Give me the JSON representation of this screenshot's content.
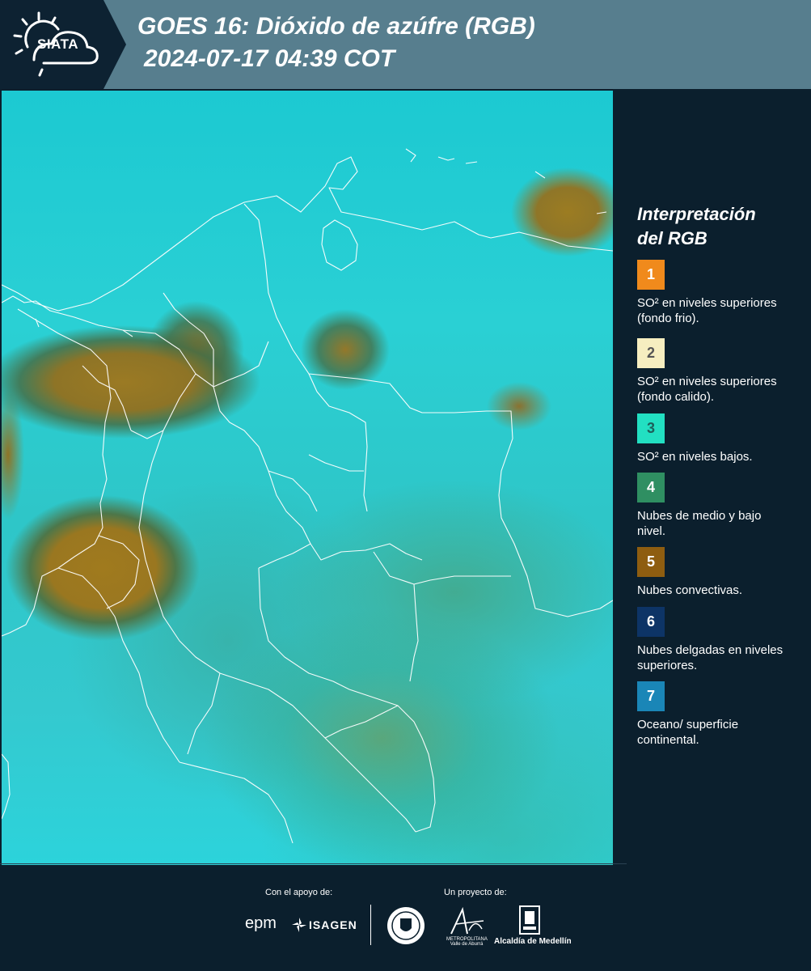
{
  "header": {
    "logo_text": "SIATA",
    "title_line1": "GOES 16: Dióxido de azúfre (RGB)",
    "title_line2": "2024-07-17 04:39 COT"
  },
  "legend": {
    "title_line1": "Interpretación",
    "title_line2": "del RGB",
    "items": [
      {
        "number": "1",
        "color": "#f08a1c",
        "label": "SO² en niveles superiores (fondo frio)."
      },
      {
        "number": "2",
        "color": "#f6eec0",
        "label": "SO² en niveles superiores (fondo calido)."
      },
      {
        "number": "3",
        "color": "#22e0c2",
        "label": "SO² en niveles bajos."
      },
      {
        "number": "4",
        "color": "#2f8f62",
        "label": "Nubes de medio y bajo nivel."
      },
      {
        "number": "5",
        "color": "#8e5d10",
        "label": "Nubes convectivas."
      },
      {
        "number": "6",
        "color": "#0d3466",
        "label": "Nubes delgadas en niveles superiores."
      },
      {
        "number": "7",
        "color": "#1a86b7",
        "label": "Oceano/ superficie continental."
      }
    ]
  },
  "footer": {
    "support_label": "Con el apoyo de:",
    "project_label": "Un proyecto de:",
    "sponsors": [
      "epm",
      "ISAGEN"
    ],
    "partners": [
      "Área Metropolitana Valle de Aburrá",
      "Alcaldía de Medellín"
    ],
    "area_caption": "METROPOLITANA Valle de Aburrá",
    "alcaldia_label": "Alcaldía de Medellín"
  }
}
